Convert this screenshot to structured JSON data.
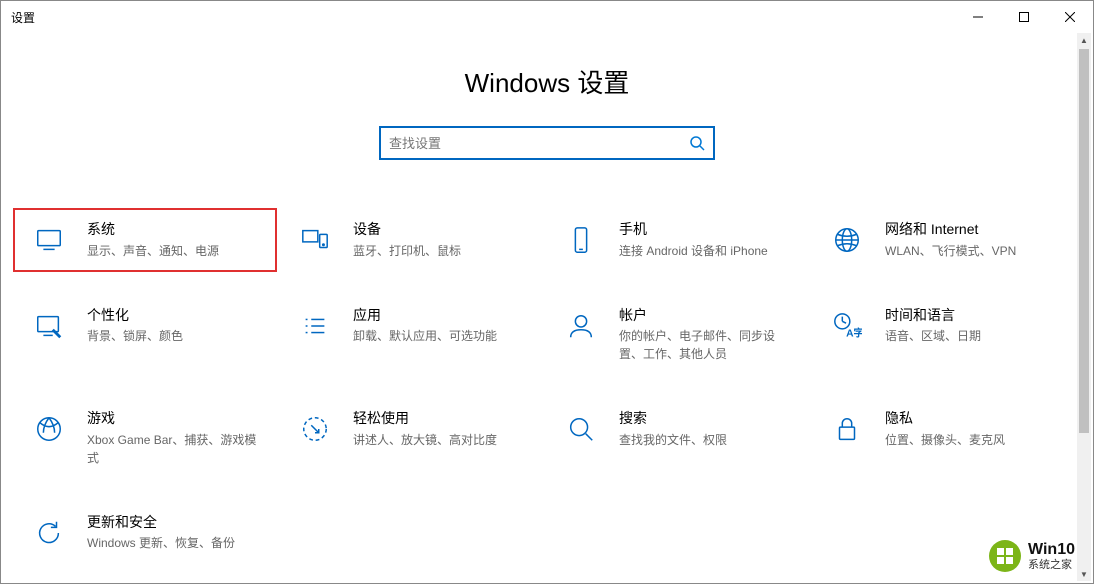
{
  "window": {
    "title": "设置"
  },
  "page_title": "Windows 设置",
  "search": {
    "placeholder": "查找设置"
  },
  "tiles": [
    {
      "title": "系统",
      "desc": "显示、声音、通知、电源",
      "highlighted": true
    },
    {
      "title": "设备",
      "desc": "蓝牙、打印机、鼠标"
    },
    {
      "title": "手机",
      "desc": "连接 Android 设备和 iPhone"
    },
    {
      "title": "网络和 Internet",
      "desc": "WLAN、飞行模式、VPN"
    },
    {
      "title": "个性化",
      "desc": "背景、锁屏、颜色"
    },
    {
      "title": "应用",
      "desc": "卸载、默认应用、可选功能"
    },
    {
      "title": "帐户",
      "desc": "你的帐户、电子邮件、同步设置、工作、其他人员"
    },
    {
      "title": "时间和语言",
      "desc": "语音、区域、日期"
    },
    {
      "title": "游戏",
      "desc": "Xbox Game Bar、捕获、游戏模式"
    },
    {
      "title": "轻松使用",
      "desc": "讲述人、放大镜、高对比度"
    },
    {
      "title": "搜索",
      "desc": "查找我的文件、权限"
    },
    {
      "title": "隐私",
      "desc": "位置、摄像头、麦克风"
    },
    {
      "title": "更新和安全",
      "desc": "Windows 更新、恢复、备份"
    }
  ],
  "watermark": {
    "line1": "Win10",
    "line2": "系统之家"
  }
}
